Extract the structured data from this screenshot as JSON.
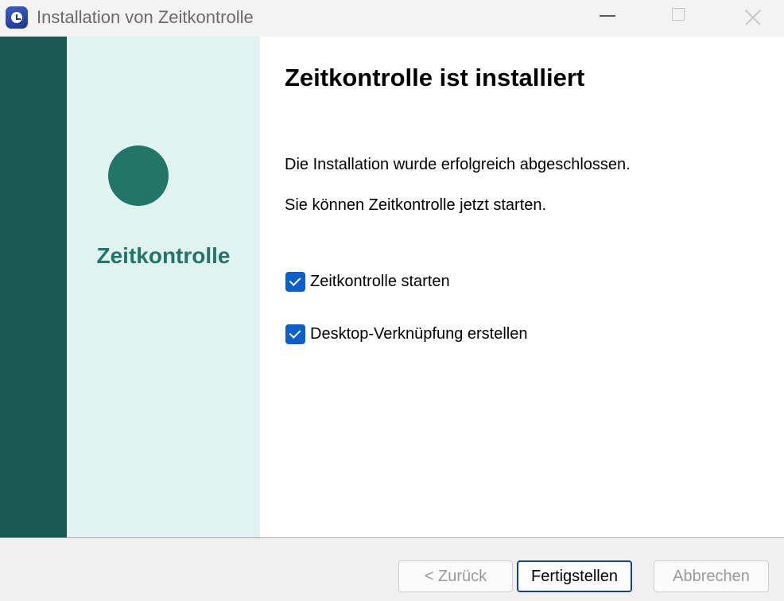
{
  "window": {
    "title": "Installation von Zeitkontrolle",
    "icon": "clock-app-icon"
  },
  "sidebar": {
    "product_name": "Zeitkontrolle",
    "colors": {
      "dark": "#1a5953",
      "light": "#e1f3f0",
      "accent": "#227667"
    }
  },
  "main": {
    "heading": "Zeitkontrolle ist installiert",
    "message_1": "Die Installation wurde erfolgreich abgeschlossen.",
    "message_2": "Sie können Zeitkontrolle jetzt starten.",
    "options": [
      {
        "label": "Zeitkontrolle starten",
        "checked": true
      },
      {
        "label": "Desktop-Verknüpfung erstellen",
        "checked": true
      }
    ]
  },
  "footer": {
    "back_label": "< Zurück",
    "finish_label": "Fertigstellen",
    "cancel_label": "Abbrechen"
  }
}
